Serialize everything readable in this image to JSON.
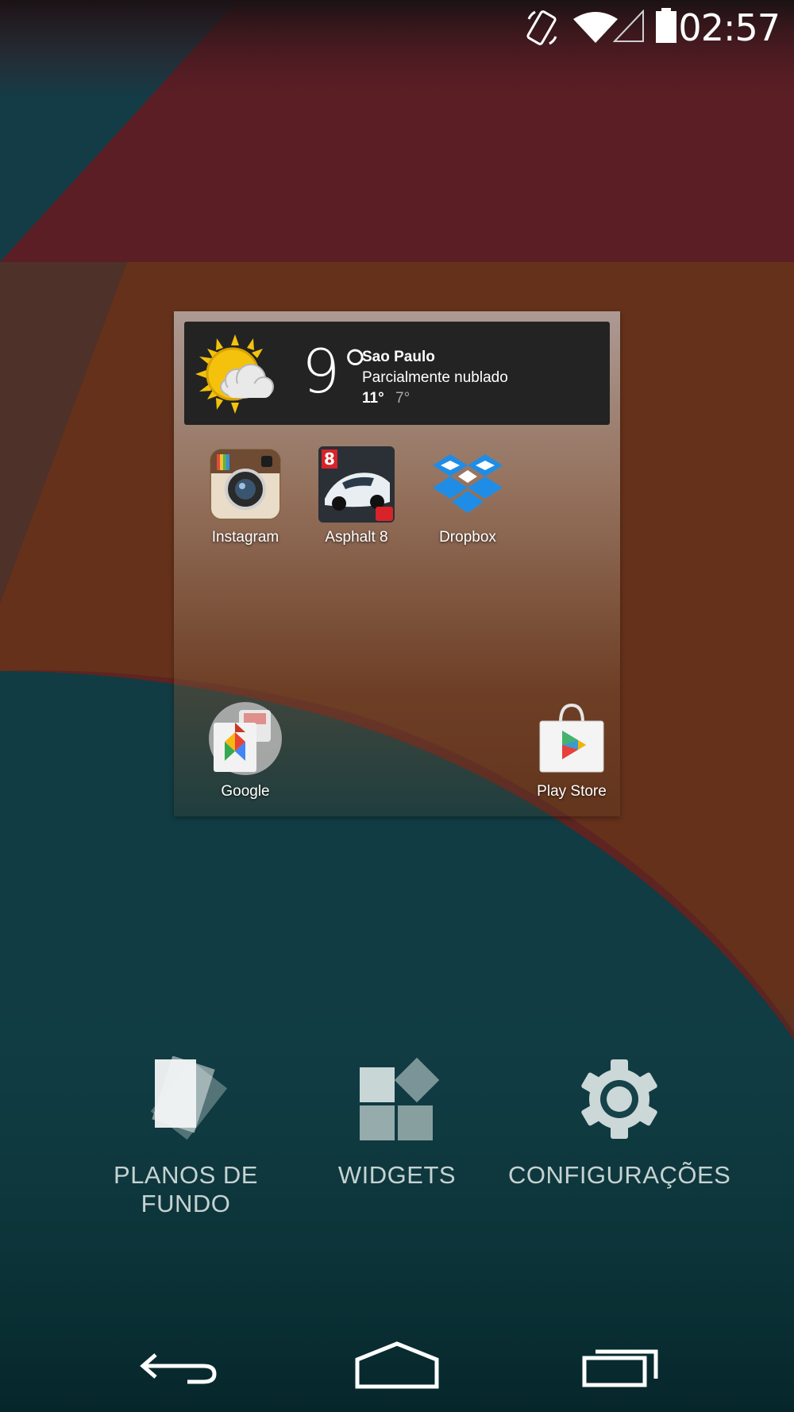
{
  "status_bar": {
    "time": "02:57",
    "icons": [
      "rotate-icon",
      "wifi-icon",
      "signal-icon",
      "battery-icon"
    ]
  },
  "weather": {
    "temperature": "9°",
    "city": "Sao Paulo",
    "condition": "Parcialmente nublado",
    "high": "11°",
    "low": "7°",
    "icon": "partly-cloudy-icon"
  },
  "apps": [
    {
      "label": "Instagram",
      "icon": "instagram-icon"
    },
    {
      "label": "Asphalt 8",
      "icon": "asphalt-8-icon"
    },
    {
      "label": "Dropbox",
      "icon": "dropbox-icon"
    },
    {
      "label": "Google",
      "icon": "google-folder-icon"
    },
    {
      "label": "Play Store",
      "icon": "play-store-icon"
    }
  ],
  "asphalt_badge": "8",
  "options": [
    {
      "label": "PLANOS DE FUNDO",
      "icon": "wallpapers-icon"
    },
    {
      "label": "WIDGETS",
      "icon": "widgets-icon"
    },
    {
      "label": "CONFIGURAÇÕES",
      "icon": "settings-gear-icon"
    }
  ],
  "nav": [
    "back-icon",
    "home-icon",
    "recents-icon"
  ],
  "colors": {
    "wallpaper_red": "#5a1e24",
    "wallpaper_teal": "#123b46",
    "wallpaper_gold": "#6a4a14",
    "option_text": "#c6d2d2",
    "weather_bg": "#232323"
  }
}
